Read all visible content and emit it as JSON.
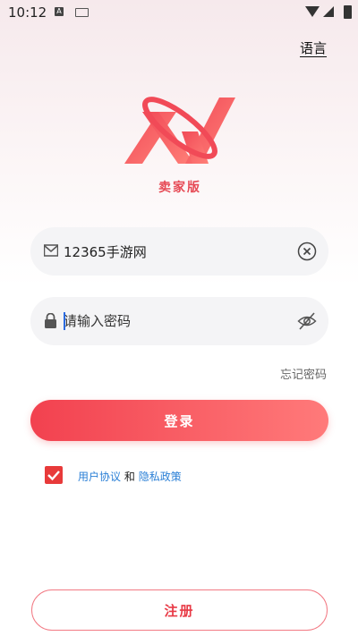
{
  "status_bar": {
    "time": "10:12",
    "notification_letter": "A"
  },
  "header": {
    "language_label": "语言"
  },
  "logo": {
    "subtitle": "卖家版"
  },
  "login_form": {
    "username_value": "12365手游网",
    "password_placeholder": "请输入密码",
    "forgot_password_label": "忘记密码",
    "login_button_label": "登录"
  },
  "agreement": {
    "checked": true,
    "user_agreement_label": "用户协议",
    "and_text": "和",
    "privacy_policy_label": "隐私政策"
  },
  "footer": {
    "register_button_label": "注册"
  },
  "colors": {
    "brand_red": "#e83a46",
    "gradient_start": "#f2414f",
    "gradient_end": "#ff7a7a",
    "link_blue": "#2a7fd6"
  }
}
